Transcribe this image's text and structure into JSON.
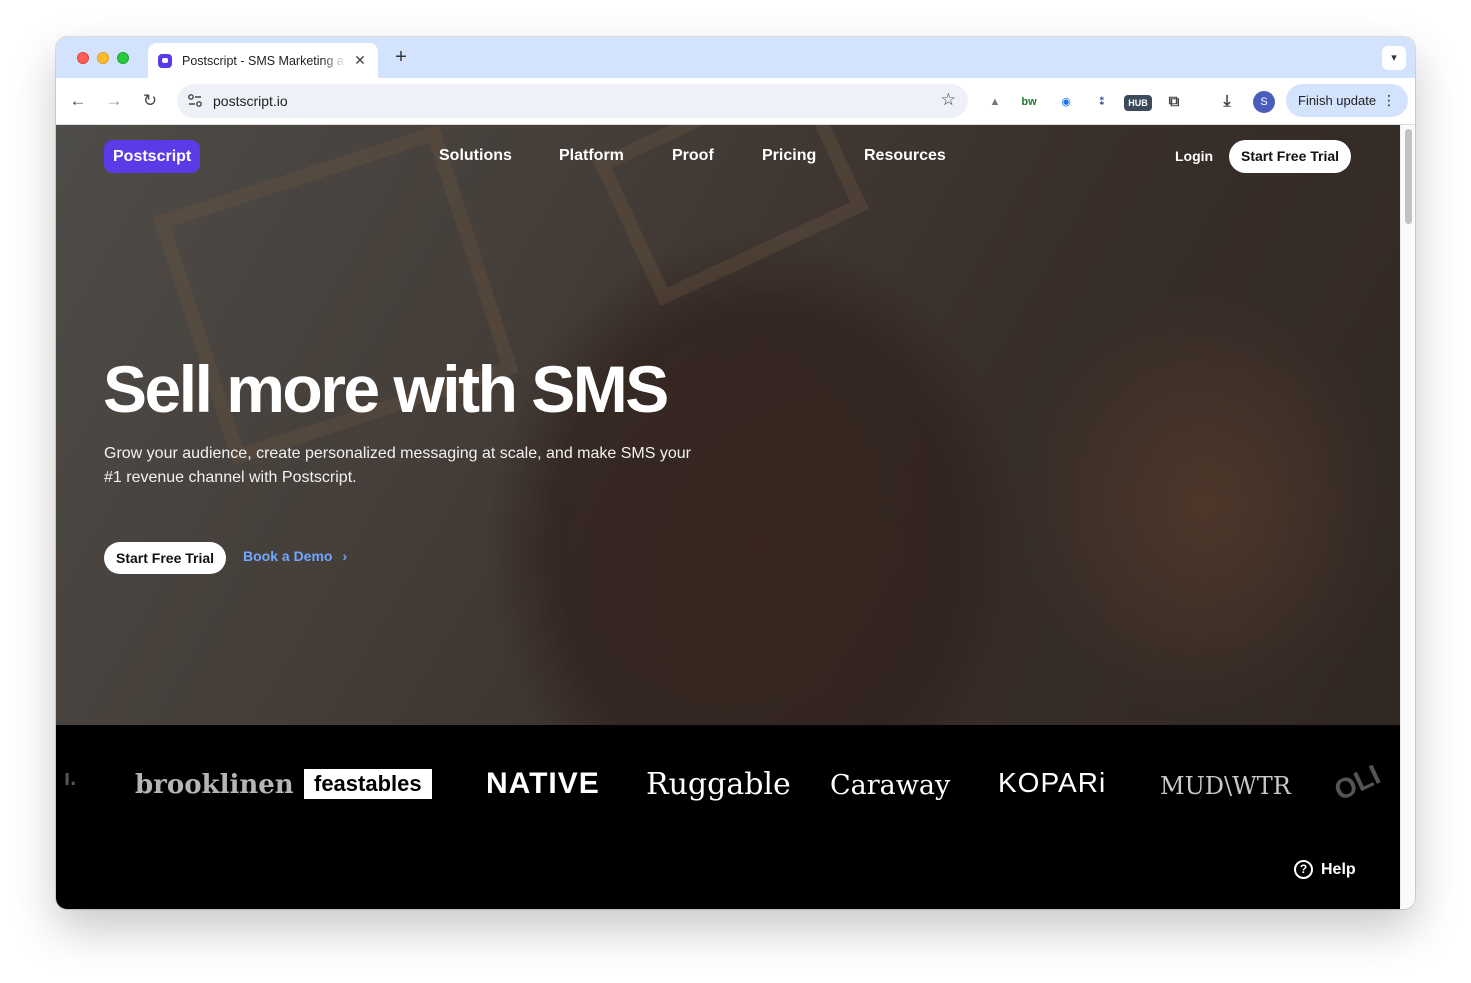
{
  "browser": {
    "tab_title": "Postscript - SMS Marketing a",
    "url": "postscript.io",
    "avatar_letter": "S",
    "finish_update": "Finish update",
    "extensions": [
      "shopify-icon",
      "bw-icon",
      "password-icon",
      "dots-icon",
      "hub-icon",
      "puzzle-icon"
    ]
  },
  "site": {
    "logo": "Postscript",
    "nav": [
      "Solutions",
      "Platform",
      "Proof",
      "Pricing",
      "Resources"
    ],
    "login": "Login",
    "cta_top": "Start Free Trial",
    "headline": "Sell more with SMS",
    "subheadline": "Grow your audience, create personalized messaging at scale, and make SMS your #1 revenue channel with Postscript.",
    "cta_hero": "Start Free Trial",
    "book_demo": "Book a Demo",
    "brands": [
      "brooklinen",
      "feastables",
      "NATIVE",
      "Ruggable",
      "Caraway",
      "KOPARi",
      "MUD\\WTR"
    ],
    "help": "Help"
  },
  "colors": {
    "brand_purple": "#5b3be8",
    "link_blue": "#6fa8ff",
    "tab_strip": "#d3e3fd"
  }
}
